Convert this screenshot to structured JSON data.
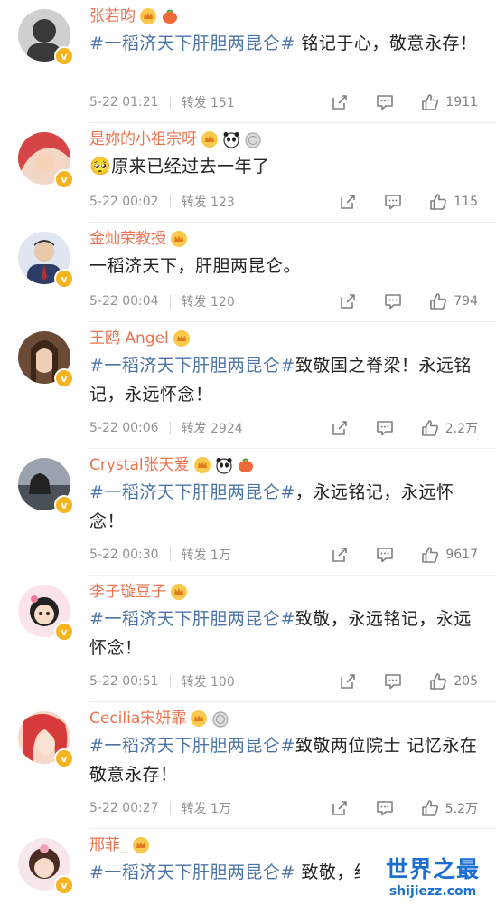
{
  "colors": {
    "username": "#eb7350",
    "topic": "#4b73a6",
    "text": "#222222",
    "meta": "#939393",
    "verified_badge": "#f6b41e",
    "watermark": "#1b6fd1"
  },
  "comments": [
    {
      "username": "张若昀",
      "medals": [
        "crown-medal-icon",
        "fruit-medal-icon"
      ],
      "topic": "#一稻济天下肝胆两昆仑#",
      "text": " 铭记于心，敬意永存！",
      "time": "5-22 01:21",
      "repost": "转发 151",
      "likes": "1911",
      "avatar_color": "#3a3a3a"
    },
    {
      "username": "是妳的小祖宗呀",
      "medals": [
        "crown-medal-icon",
        "panda-medal-icon",
        "silver-medal-icon"
      ],
      "topic": "",
      "text": "🥺原来已经过去一年了",
      "time": "5-22 00:02",
      "repost": "转发 123",
      "likes": "115",
      "avatar_color": "#d64545"
    },
    {
      "username": "金灿荣教授",
      "medals": [
        "crown-medal-icon"
      ],
      "topic": "",
      "text": "一稻济天下，肝胆两昆仑。",
      "time": "5-22 00:04",
      "repost": "转发 120",
      "likes": "794",
      "avatar_color": "#2c3e66"
    },
    {
      "username": "王鸥 Angel",
      "medals": [
        "crown-medal-icon"
      ],
      "topic": "#一稻济天下肝胆两昆仑#",
      "text": "致敬国之脊梁！永远铭记，永远怀念！",
      "time": "5-22 00:06",
      "repost": "转发 2924",
      "likes": "2.2万",
      "avatar_color": "#8a5a3c"
    },
    {
      "username": "Crystal张天爱",
      "medals": [
        "crown-medal-icon",
        "panda-medal-icon",
        "fruit-medal-icon"
      ],
      "topic": "#一稻济天下肝胆两昆仑#",
      "text": "，永远铭记，永远怀念！",
      "time": "5-22 00:30",
      "repost": "转发 1万",
      "likes": "9617",
      "avatar_color": "#5a6470"
    },
    {
      "username": "李子璇豆子",
      "medals": [
        "crown-medal-icon"
      ],
      "topic": "#一稻济天下肝胆两昆仑#",
      "text": "致敬，永远铭记，永远怀念！",
      "time": "5-22 00:51",
      "repost": "转发 100",
      "likes": "205",
      "avatar_color": "#f0c6d2"
    },
    {
      "username": "Cecilia宋妍霏",
      "medals": [
        "crown-medal-icon",
        "silver-medal-icon"
      ],
      "topic": "#一稻济天下肝胆两昆仑#",
      "text": "致敬两位院士 记忆永在 敬意永存！",
      "time": "5-22 00:27",
      "repost": "转发 1万",
      "likes": "5.2万",
      "avatar_color": "#d63a3a"
    },
    {
      "username": "邢菲_",
      "medals": [
        "crown-medal-icon"
      ],
      "topic": "#一稻济天下肝胆两昆仑#",
      "text": " 致敬，细",
      "time": "",
      "repost": "",
      "likes": "",
      "avatar_color": "#e8b8c4"
    }
  ],
  "watermark": {
    "title": "世界之最",
    "url": "shijiezz.com"
  }
}
